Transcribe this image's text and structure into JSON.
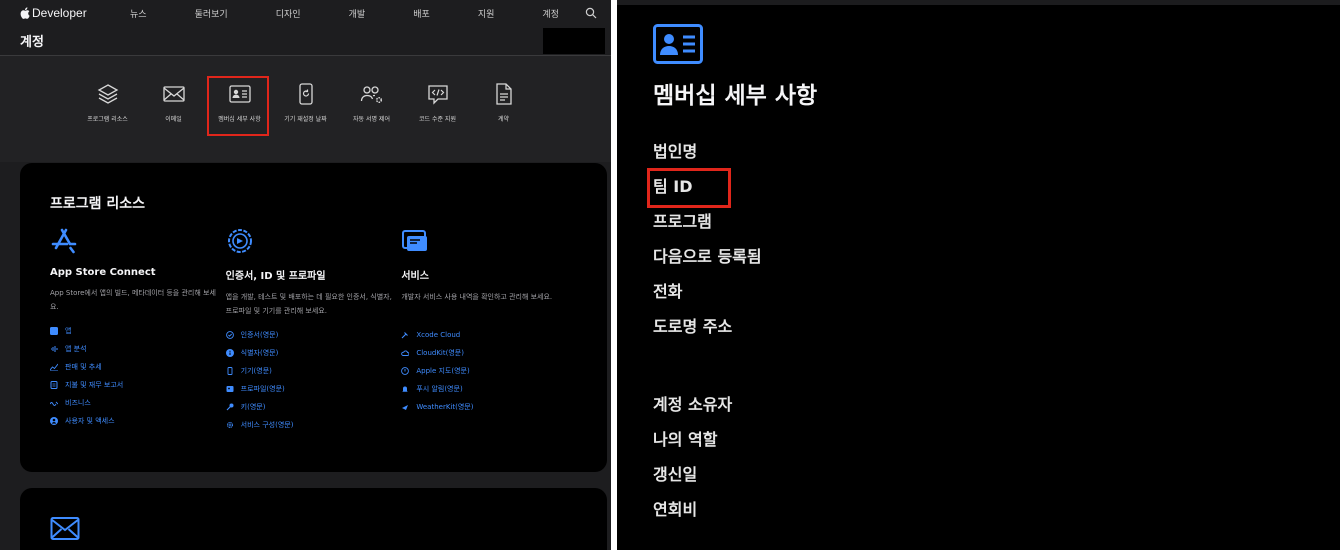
{
  "left": {
    "brand": "Developer",
    "nav": [
      "뉴스",
      "둘러보기",
      "디자인",
      "개발",
      "배포",
      "지원",
      "계정"
    ],
    "page_title": "계정",
    "shortcuts": [
      {
        "label": "프로그램 리소스",
        "icon": "layers-icon"
      },
      {
        "label": "이메일",
        "icon": "envelope-icon"
      },
      {
        "label": "멤버십 세부 사항",
        "icon": "id-card-icon",
        "selected": true
      },
      {
        "label": "기기 재설정 날짜",
        "icon": "device-reset-icon"
      },
      {
        "label": "자동 서명 제어",
        "icon": "people-gear-icon"
      },
      {
        "label": "코드 수준 지원",
        "icon": "code-bubble-icon"
      },
      {
        "label": "계약",
        "icon": "document-icon"
      }
    ],
    "program_resources": {
      "title": "프로그램 리소스",
      "columns": [
        {
          "title": "App Store Connect",
          "icon": "app-store-icon",
          "desc": "App Store에서 앱의 빌드, 메타데이터 등을 관리해 보세요.",
          "links": [
            "앱",
            "앱 분석",
            "판매 및 추세",
            "지불 및 재무 보고서",
            "비즈니스",
            "사용자 및 액세스"
          ]
        },
        {
          "title": "인증서, ID 및 프로파일",
          "icon": "gear-badge-icon",
          "desc": "앱을 개발, 테스트 및 배포하는 데 필요한 인증서, 식별자, 프로파일 및 기기를 관리해 보세요.",
          "links": [
            "인증서(영문)",
            "식별자(영문)",
            "기기(영문)",
            "프로파일(영문)",
            "키(영문)",
            "서비스 구성(영문)"
          ]
        },
        {
          "title": "서비스",
          "icon": "services-window-icon",
          "desc": "개발자 서비스 사용 내역을 확인하고 관리해 보세요.",
          "links": [
            "Xcode Cloud",
            "CloudKit(영문)",
            "Apple 지도(영문)",
            "푸시 알림(영문)",
            "WeatherKit(영문)"
          ]
        }
      ]
    }
  },
  "right": {
    "title": "멤버십 세부 사항",
    "fields": [
      "법인명",
      "팀 ID",
      "프로그램",
      "다음으로 등록됨",
      "전화",
      "도로명 주소"
    ],
    "fields2": [
      "계정 소유자",
      "나의 역할",
      "갱신일",
      "연회비"
    ],
    "highlighted": "팀 ID"
  },
  "colors": {
    "accent": "#3f8cff",
    "highlight": "#e0261b",
    "bg_dark": "#1d1d1f"
  }
}
